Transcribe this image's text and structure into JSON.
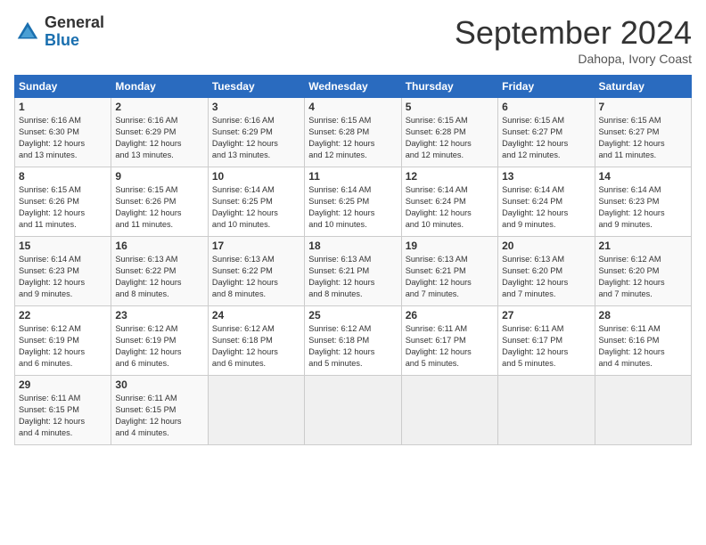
{
  "header": {
    "logo_line1": "General",
    "logo_line2": "Blue",
    "month": "September 2024",
    "location": "Dahopa, Ivory Coast"
  },
  "days_of_week": [
    "Sunday",
    "Monday",
    "Tuesday",
    "Wednesday",
    "Thursday",
    "Friday",
    "Saturday"
  ],
  "weeks": [
    [
      {
        "day": "1",
        "lines": [
          "Sunrise: 6:16 AM",
          "Sunset: 6:30 PM",
          "Daylight: 12 hours",
          "and 13 minutes."
        ]
      },
      {
        "day": "2",
        "lines": [
          "Sunrise: 6:16 AM",
          "Sunset: 6:29 PM",
          "Daylight: 12 hours",
          "and 13 minutes."
        ]
      },
      {
        "day": "3",
        "lines": [
          "Sunrise: 6:16 AM",
          "Sunset: 6:29 PM",
          "Daylight: 12 hours",
          "and 13 minutes."
        ]
      },
      {
        "day": "4",
        "lines": [
          "Sunrise: 6:15 AM",
          "Sunset: 6:28 PM",
          "Daylight: 12 hours",
          "and 12 minutes."
        ]
      },
      {
        "day": "5",
        "lines": [
          "Sunrise: 6:15 AM",
          "Sunset: 6:28 PM",
          "Daylight: 12 hours",
          "and 12 minutes."
        ]
      },
      {
        "day": "6",
        "lines": [
          "Sunrise: 6:15 AM",
          "Sunset: 6:27 PM",
          "Daylight: 12 hours",
          "and 12 minutes."
        ]
      },
      {
        "day": "7",
        "lines": [
          "Sunrise: 6:15 AM",
          "Sunset: 6:27 PM",
          "Daylight: 12 hours",
          "and 11 minutes."
        ]
      }
    ],
    [
      {
        "day": "8",
        "lines": [
          "Sunrise: 6:15 AM",
          "Sunset: 6:26 PM",
          "Daylight: 12 hours",
          "and 11 minutes."
        ]
      },
      {
        "day": "9",
        "lines": [
          "Sunrise: 6:15 AM",
          "Sunset: 6:26 PM",
          "Daylight: 12 hours",
          "and 11 minutes."
        ]
      },
      {
        "day": "10",
        "lines": [
          "Sunrise: 6:14 AM",
          "Sunset: 6:25 PM",
          "Daylight: 12 hours",
          "and 10 minutes."
        ]
      },
      {
        "day": "11",
        "lines": [
          "Sunrise: 6:14 AM",
          "Sunset: 6:25 PM",
          "Daylight: 12 hours",
          "and 10 minutes."
        ]
      },
      {
        "day": "12",
        "lines": [
          "Sunrise: 6:14 AM",
          "Sunset: 6:24 PM",
          "Daylight: 12 hours",
          "and 10 minutes."
        ]
      },
      {
        "day": "13",
        "lines": [
          "Sunrise: 6:14 AM",
          "Sunset: 6:24 PM",
          "Daylight: 12 hours",
          "and 9 minutes."
        ]
      },
      {
        "day": "14",
        "lines": [
          "Sunrise: 6:14 AM",
          "Sunset: 6:23 PM",
          "Daylight: 12 hours",
          "and 9 minutes."
        ]
      }
    ],
    [
      {
        "day": "15",
        "lines": [
          "Sunrise: 6:14 AM",
          "Sunset: 6:23 PM",
          "Daylight: 12 hours",
          "and 9 minutes."
        ]
      },
      {
        "day": "16",
        "lines": [
          "Sunrise: 6:13 AM",
          "Sunset: 6:22 PM",
          "Daylight: 12 hours",
          "and 8 minutes."
        ]
      },
      {
        "day": "17",
        "lines": [
          "Sunrise: 6:13 AM",
          "Sunset: 6:22 PM",
          "Daylight: 12 hours",
          "and 8 minutes."
        ]
      },
      {
        "day": "18",
        "lines": [
          "Sunrise: 6:13 AM",
          "Sunset: 6:21 PM",
          "Daylight: 12 hours",
          "and 8 minutes."
        ]
      },
      {
        "day": "19",
        "lines": [
          "Sunrise: 6:13 AM",
          "Sunset: 6:21 PM",
          "Daylight: 12 hours",
          "and 7 minutes."
        ]
      },
      {
        "day": "20",
        "lines": [
          "Sunrise: 6:13 AM",
          "Sunset: 6:20 PM",
          "Daylight: 12 hours",
          "and 7 minutes."
        ]
      },
      {
        "day": "21",
        "lines": [
          "Sunrise: 6:12 AM",
          "Sunset: 6:20 PM",
          "Daylight: 12 hours",
          "and 7 minutes."
        ]
      }
    ],
    [
      {
        "day": "22",
        "lines": [
          "Sunrise: 6:12 AM",
          "Sunset: 6:19 PM",
          "Daylight: 12 hours",
          "and 6 minutes."
        ]
      },
      {
        "day": "23",
        "lines": [
          "Sunrise: 6:12 AM",
          "Sunset: 6:19 PM",
          "Daylight: 12 hours",
          "and 6 minutes."
        ]
      },
      {
        "day": "24",
        "lines": [
          "Sunrise: 6:12 AM",
          "Sunset: 6:18 PM",
          "Daylight: 12 hours",
          "and 6 minutes."
        ]
      },
      {
        "day": "25",
        "lines": [
          "Sunrise: 6:12 AM",
          "Sunset: 6:18 PM",
          "Daylight: 12 hours",
          "and 5 minutes."
        ]
      },
      {
        "day": "26",
        "lines": [
          "Sunrise: 6:11 AM",
          "Sunset: 6:17 PM",
          "Daylight: 12 hours",
          "and 5 minutes."
        ]
      },
      {
        "day": "27",
        "lines": [
          "Sunrise: 6:11 AM",
          "Sunset: 6:17 PM",
          "Daylight: 12 hours",
          "and 5 minutes."
        ]
      },
      {
        "day": "28",
        "lines": [
          "Sunrise: 6:11 AM",
          "Sunset: 6:16 PM",
          "Daylight: 12 hours",
          "and 4 minutes."
        ]
      }
    ],
    [
      {
        "day": "29",
        "lines": [
          "Sunrise: 6:11 AM",
          "Sunset: 6:15 PM",
          "Daylight: 12 hours",
          "and 4 minutes."
        ]
      },
      {
        "day": "30",
        "lines": [
          "Sunrise: 6:11 AM",
          "Sunset: 6:15 PM",
          "Daylight: 12 hours",
          "and 4 minutes."
        ]
      },
      {
        "day": "",
        "lines": []
      },
      {
        "day": "",
        "lines": []
      },
      {
        "day": "",
        "lines": []
      },
      {
        "day": "",
        "lines": []
      },
      {
        "day": "",
        "lines": []
      }
    ]
  ]
}
